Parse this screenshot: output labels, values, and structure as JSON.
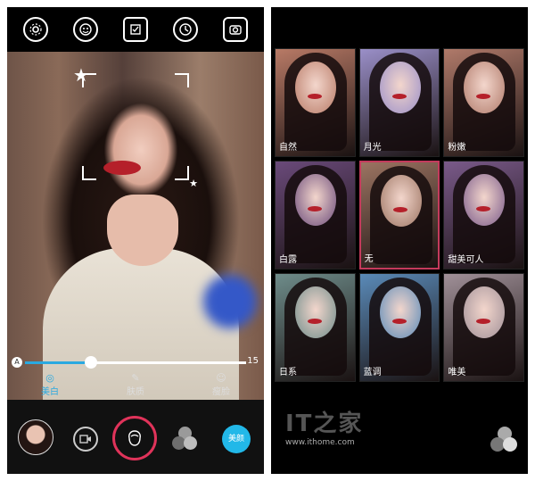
{
  "left": {
    "topbar_icons": [
      "settings-icon",
      "face-beauty-icon",
      "checklist-icon",
      "clock-icon",
      "flip-camera-icon"
    ],
    "slider": {
      "min_label": "A",
      "max_label": "15",
      "value_fraction": 0.3
    },
    "beauty_tabs": [
      {
        "label": "美白",
        "active": true
      },
      {
        "label": "肤质",
        "active": false
      },
      {
        "label": "瘦脸",
        "active": false
      }
    ],
    "bottom": {
      "beauty_button_label": "美颜"
    }
  },
  "right": {
    "filters": [
      {
        "label": "自然",
        "tint": "#b87a66"
      },
      {
        "label": "月光",
        "tint": "#9a8fc8"
      },
      {
        "label": "粉嫩",
        "tint": "#b07a6a"
      },
      {
        "label": "白露",
        "tint": "#6a4a7a"
      },
      {
        "label": "无",
        "tint": "#9c7462",
        "selected": true
      },
      {
        "label": "甜美可人",
        "tint": "#7a5a8a"
      },
      {
        "label": "日系",
        "tint": "#6e8c8a"
      },
      {
        "label": "蓝调",
        "tint": "#5a8ab8"
      },
      {
        "label": "唯美",
        "tint": "#a09098"
      }
    ],
    "watermark": {
      "logo": "IT之家",
      "url": "www.ithome.com"
    }
  }
}
